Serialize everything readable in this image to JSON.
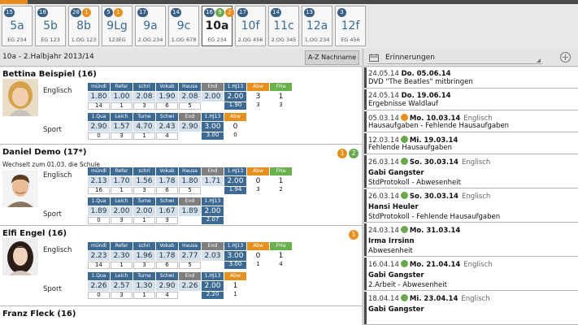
{
  "classes": [
    {
      "name": "5a",
      "room": "EG 234",
      "badges": [
        {
          "t": "15",
          "c": "n"
        }
      ],
      "selected": false
    },
    {
      "name": "5b",
      "room": "EG 123",
      "badges": [
        {
          "t": "18",
          "c": "n"
        }
      ],
      "selected": false
    },
    {
      "name": "8b",
      "room": "1.OG 123",
      "badges": [
        {
          "t": "28",
          "c": "n"
        },
        {
          "t": "1",
          "c": "o"
        }
      ],
      "selected": false
    },
    {
      "name": "9Lg",
      "room": "123EG",
      "badges": [
        {
          "t": "5",
          "c": "n"
        },
        {
          "t": "1",
          "c": "o"
        }
      ],
      "selected": false
    },
    {
      "name": "9a",
      "room": "2.OG 234",
      "badges": [
        {
          "t": "17",
          "c": "n"
        }
      ],
      "selected": false
    },
    {
      "name": "9c",
      "room": "1.OG 678",
      "badges": [
        {
          "t": "14",
          "c": "n"
        }
      ],
      "selected": false
    },
    {
      "name": "10a",
      "room": "EG 234",
      "badges": [
        {
          "t": "16",
          "c": "n"
        },
        {
          "t": "9",
          "c": "g"
        },
        {
          "t": "2",
          "c": "o"
        }
      ],
      "selected": true
    },
    {
      "name": "10f",
      "room": "2.OG 456",
      "badges": [
        {
          "t": "17",
          "c": "n"
        }
      ],
      "selected": false
    },
    {
      "name": "11c",
      "room": "2.OG 345",
      "badges": [
        {
          "t": "14",
          "c": "n"
        }
      ],
      "selected": false
    },
    {
      "name": "12a",
      "room": "1.OG 234",
      "badges": [
        {
          "t": "13",
          "c": "n"
        }
      ],
      "selected": false
    },
    {
      "name": "12f",
      "room": "EG 456",
      "badges": [
        {
          "t": "3",
          "c": "n"
        }
      ],
      "selected": false
    }
  ],
  "header": {
    "title": "10a - 2.Halbjahr 2013/14",
    "sort_label": "A-Z Nachname"
  },
  "students": [
    {
      "name": "Bettina Beispiel  (16)",
      "note": "",
      "badges": [],
      "avatar": "female-blond",
      "rows": [
        {
          "subject": "Englisch",
          "headers": [
            "mündl",
            "Refer",
            "schri",
            "Vokab",
            "Hausa",
            "End",
            "1.HJ13",
            "Abw",
            "FHa"
          ],
          "hclass": [
            "",
            "",
            "",
            "",
            "",
            "gray",
            "",
            "orange",
            "green"
          ],
          "values": [
            "1.80",
            "1.00",
            "2.08",
            "1.90",
            "2.08",
            "2.00",
            "2.00",
            "3",
            "1"
          ],
          "vclass": [
            "",
            "",
            "",
            "",
            "",
            "",
            "dark",
            "plain",
            "plain"
          ],
          "counts": [
            "14",
            "1",
            "3",
            "6",
            "5",
            "",
            "1.90",
            "3",
            "3"
          ],
          "cclass": [
            "",
            "",
            "",
            "",
            "",
            "plain",
            "dark",
            "plain",
            "plain"
          ]
        },
        {
          "subject": "Sport",
          "headers": [
            "1.Qua",
            "Leich",
            "Turne",
            "Schwi",
            "End",
            "1.HJ13",
            "Abw",
            "",
            ""
          ],
          "hclass": [
            "",
            "",
            "",
            "",
            "gray",
            "",
            "orange",
            "",
            ""
          ],
          "values": [
            "2.90",
            "1.57",
            "4.70",
            "2.43",
            "2.90",
            "3.00",
            "0",
            "",
            ""
          ],
          "vclass": [
            "",
            "",
            "",
            "",
            "",
            "dark",
            "plain",
            "",
            ""
          ],
          "counts": [
            "0",
            "3",
            "1",
            "4",
            "",
            "3.00",
            "0",
            "",
            ""
          ],
          "cclass": [
            "",
            "",
            "",
            "",
            "plain",
            "dark",
            "plain",
            "",
            ""
          ]
        }
      ]
    },
    {
      "name": "Daniel Demo  (17*)",
      "note": "Wechselt zum 01.03. die Schule",
      "badges": [
        {
          "t": "1",
          "c": "o"
        },
        {
          "t": "2",
          "c": "g"
        }
      ],
      "avatar": "male",
      "rows": [
        {
          "subject": "Englisch",
          "headers": [
            "mündl",
            "Refer",
            "schri",
            "Vokab",
            "Hausa",
            "End",
            "1.HJ13",
            "Abw",
            "FHa"
          ],
          "hclass": [
            "",
            "",
            "",
            "",
            "",
            "gray",
            "",
            "orange",
            "green"
          ],
          "values": [
            "2.13",
            "1.70",
            "1.56",
            "1.78",
            "1.80",
            "1.71",
            "2.00",
            "0",
            "1"
          ],
          "vclass": [
            "",
            "",
            "",
            "",
            "",
            "",
            "dark",
            "plain",
            "plain"
          ],
          "counts": [
            "16",
            "1",
            "3",
            "6",
            "5",
            "",
            "1.94",
            "3",
            "2"
          ],
          "cclass": [
            "",
            "",
            "",
            "",
            "",
            "plain",
            "dark",
            "plain",
            "plain"
          ]
        },
        {
          "subject": "Sport",
          "headers": [
            "1.Qua",
            "Leich",
            "Turne",
            "Schwi",
            "End",
            "1.HJ13",
            "",
            "",
            ""
          ],
          "hclass": [
            "",
            "",
            "",
            "",
            "gray",
            "",
            "",
            "",
            ""
          ],
          "values": [
            "1.89",
            "2.00",
            "2.00",
            "1.67",
            "1.89",
            "2.00",
            "",
            "",
            ""
          ],
          "vclass": [
            "",
            "",
            "",
            "",
            "",
            "dark",
            "",
            "",
            ""
          ],
          "counts": [
            "0",
            "3",
            "1",
            "3",
            "",
            "2.07",
            "",
            "",
            ""
          ],
          "cclass": [
            "",
            "",
            "",
            "",
            "plain",
            "dark",
            "",
            "",
            ""
          ]
        }
      ]
    },
    {
      "name": "Elfi Engel  (16)",
      "note": "",
      "badges": [
        {
          "t": "1",
          "c": "o"
        }
      ],
      "avatar": "female-dark",
      "rows": [
        {
          "subject": "Englisch",
          "headers": [
            "mündl",
            "Refer",
            "schri",
            "Vokab",
            "Hausa",
            "End",
            "1.HJ13",
            "Abw",
            "FHa"
          ],
          "hclass": [
            "",
            "",
            "",
            "",
            "",
            "gray",
            "",
            "orange",
            "green"
          ],
          "values": [
            "2.23",
            "2.30",
            "1.96",
            "1.78",
            "2.77",
            "2.03",
            "3.00",
            "0",
            "1"
          ],
          "vclass": [
            "",
            "",
            "",
            "",
            "",
            "",
            "dark",
            "plain",
            "plain"
          ],
          "counts": [
            "14",
            "1",
            "3",
            "6",
            "5",
            "",
            "3.00",
            "1",
            "4"
          ],
          "cclass": [
            "",
            "",
            "",
            "",
            "",
            "plain",
            "dark",
            "plain",
            "plain"
          ]
        },
        {
          "subject": "Sport",
          "headers": [
            "1.Qua",
            "Leich",
            "Turne",
            "Schwi",
            "End",
            "1.HJ13",
            "Abw",
            "",
            ""
          ],
          "hclass": [
            "",
            "",
            "",
            "",
            "gray",
            "",
            "orange",
            "",
            ""
          ],
          "values": [
            "2.26",
            "2.57",
            "1.30",
            "2.90",
            "2.26",
            "2.00",
            "1",
            "",
            ""
          ],
          "vclass": [
            "",
            "",
            "",
            "",
            "",
            "dark",
            "plain",
            "",
            ""
          ],
          "counts": [
            "0",
            "3",
            "1",
            "4",
            "",
            "2.20",
            "1",
            "",
            ""
          ],
          "cclass": [
            "",
            "",
            "",
            "",
            "plain",
            "dark",
            "plain",
            "",
            ""
          ]
        }
      ]
    },
    {
      "name": "Franz Fleck  (16)",
      "note": "",
      "badges": [],
      "avatar": "none",
      "rows": []
    }
  ],
  "reminders_header": {
    "label": "Erinnerungen",
    "add": "+"
  },
  "reminders": [
    {
      "date": "24.05.14",
      "due": "Do. 05.06.14",
      "subject": "",
      "dot": "",
      "person": "",
      "text": "DVD \"The Beatles\" mitbringen"
    },
    {
      "date": "24.05.14",
      "due": "Do. 19.06.14",
      "subject": "",
      "dot": "",
      "person": "",
      "text": "Ergebnisse Waldlauf"
    },
    {
      "date": "05.03.14",
      "due": "Mo. 10.03.14",
      "subject": "Englisch",
      "dot": "o",
      "person": "",
      "text": "Hausaufgaben - Fehlende Hausaufgaben"
    },
    {
      "date": "12.03.14",
      "due": "Mi. 19.03.14",
      "subject": "",
      "dot": "g",
      "person": "",
      "text": "Fehlende Hausaufgaben"
    },
    {
      "date": "26.03.14",
      "due": "So. 30.03.14",
      "subject": "Englisch",
      "dot": "g",
      "person": "Gabi Gangster",
      "text": "StdProtokoll - Abwesenheit"
    },
    {
      "date": "26.03.14",
      "due": "So. 30.03.14",
      "subject": "Englisch",
      "dot": "g",
      "person": "Hansi Heuler",
      "text": "StdProtokoll - Fehlende Hausaufgaben"
    },
    {
      "date": "24.03.14",
      "due": "Mo. 31.03.14",
      "subject": "",
      "dot": "g",
      "person": "Irma Irrsinn",
      "text": "Abwesenheit"
    },
    {
      "date": "16.04.14",
      "due": "Mo. 21.04.14",
      "subject": "Englisch",
      "dot": "g",
      "person": "Gabi Gangster",
      "text": "2.Arbeit - Abwesenheit"
    },
    {
      "date": "18.04.14",
      "due": "Mi. 23.04.14",
      "subject": "Englisch",
      "dot": "g",
      "person": "Gabi Gangster",
      "text": ""
    }
  ],
  "colors": {
    "accent": "#3d6a92",
    "orange": "#e8901e",
    "green": "#6aa84f"
  }
}
